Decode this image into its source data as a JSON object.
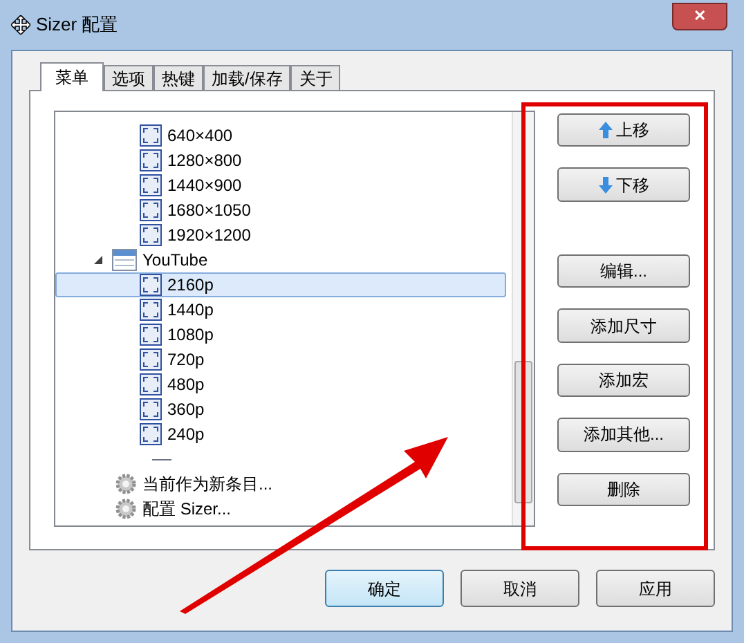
{
  "window": {
    "title": "Sizer 配置",
    "close": "✕"
  },
  "tabs": [
    {
      "label": "菜单",
      "selected": true
    },
    {
      "label": "选项",
      "selected": false
    },
    {
      "label": "热键",
      "selected": false
    },
    {
      "label": "加载/保存",
      "selected": false
    },
    {
      "label": "关于",
      "selected": false
    }
  ],
  "tree": {
    "items": [
      {
        "kind": "size",
        "label": "640×400",
        "selected": false
      },
      {
        "kind": "size",
        "label": "1280×800",
        "selected": false
      },
      {
        "kind": "size",
        "label": "1440×900",
        "selected": false
      },
      {
        "kind": "size",
        "label": "1680×1050",
        "selected": false
      },
      {
        "kind": "size",
        "label": "1920×1200",
        "selected": false
      },
      {
        "kind": "group",
        "label": "YouTube",
        "expanded": true,
        "selected": false,
        "children": [
          {
            "kind": "size",
            "label": "2160p",
            "selected": true
          },
          {
            "kind": "size",
            "label": "1440p",
            "selected": false
          },
          {
            "kind": "size",
            "label": "1080p",
            "selected": false
          },
          {
            "kind": "size",
            "label": "720p",
            "selected": false
          },
          {
            "kind": "size",
            "label": "480p",
            "selected": false
          },
          {
            "kind": "size",
            "label": "360p",
            "selected": false
          },
          {
            "kind": "size",
            "label": "240p",
            "selected": false
          }
        ]
      },
      {
        "kind": "separator"
      },
      {
        "kind": "action",
        "label": "当前作为新条目...",
        "selected": false
      },
      {
        "kind": "action",
        "label": "配置 Sizer...",
        "selected": false
      }
    ]
  },
  "side_buttons": [
    {
      "kind": "up",
      "label": "上移"
    },
    {
      "kind": "down",
      "label": "下移"
    },
    {
      "kind": "gap"
    },
    {
      "kind": "plain",
      "label": "编辑..."
    },
    {
      "kind": "plain",
      "label": "添加尺寸"
    },
    {
      "kind": "plain",
      "label": "添加宏"
    },
    {
      "kind": "plain",
      "label": "添加其他..."
    },
    {
      "kind": "plain",
      "label": "删除"
    }
  ],
  "footer_buttons": [
    {
      "label": "确定",
      "default": true
    },
    {
      "label": "取消",
      "default": false
    },
    {
      "label": "应用",
      "default": false
    }
  ]
}
